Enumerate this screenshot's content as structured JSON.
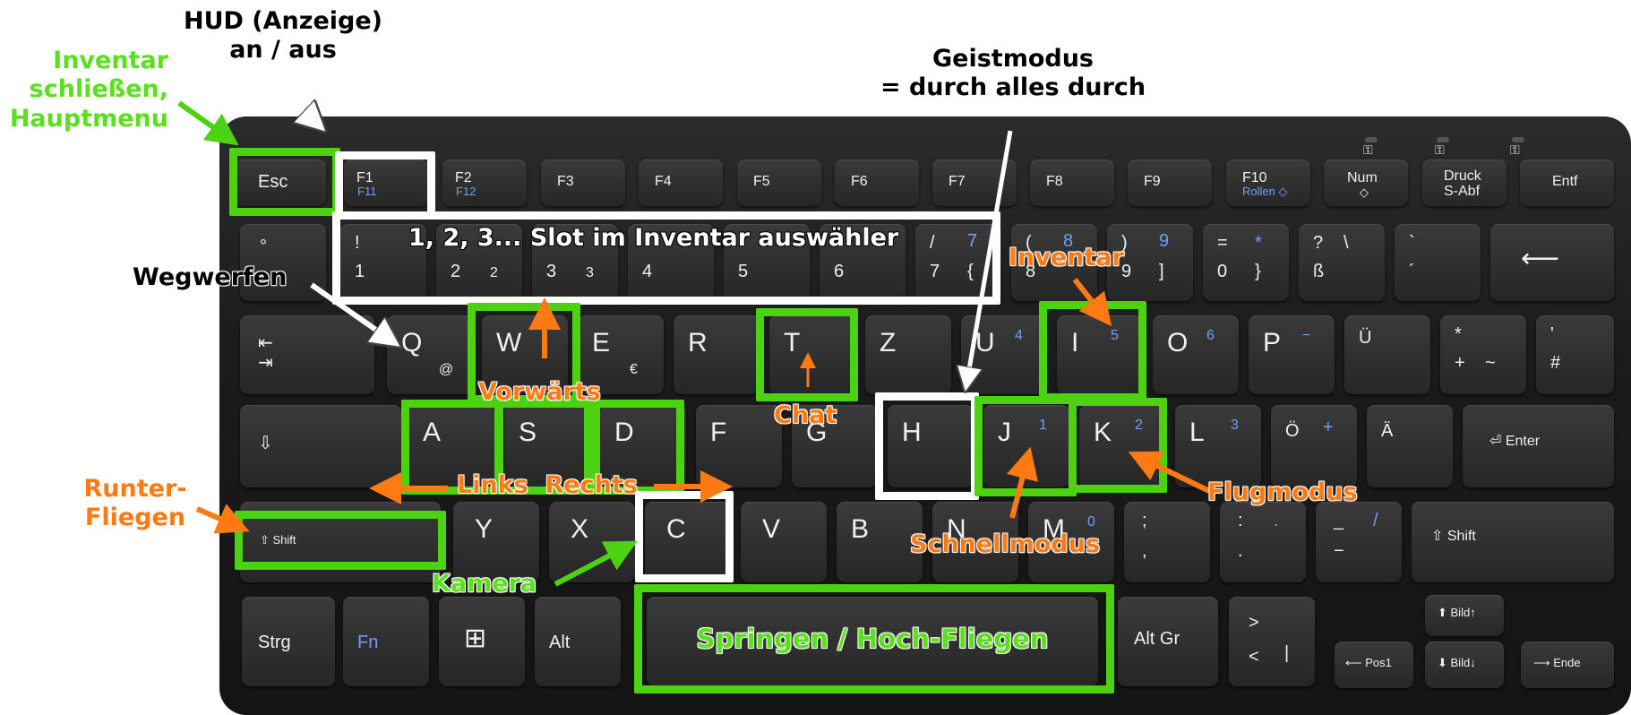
{
  "keys": {
    "esc": "Esc",
    "f1": "F1",
    "f1_sub": "F11",
    "f2": "F2",
    "f2_sub": "F12",
    "f3": "F3",
    "f4": "F4",
    "f5": "F5",
    "f6": "F6",
    "f7": "F7",
    "f8": "F8",
    "f9": "F9",
    "f10": "F10",
    "f10_sub": "Rollen ◇",
    "num": "Num",
    "num_sub": "◇",
    "druck": "Druck",
    "druck_sub": "S-Abf",
    "entf": "Entf",
    "circ": "°",
    "n1_top": "!",
    "n1": "1",
    "n2": "2",
    "n2_sup": "2",
    "n3": "3",
    "n3_sup": "3",
    "n4": "4",
    "n5": "5",
    "n6": "6",
    "n7_top": "/",
    "n7_blue": "7",
    "n7": "7",
    "n7_b": "{",
    "n8_top": "(",
    "n8_blue": "8",
    "n8": "8",
    "n9_top": ")",
    "n9_blue": "9",
    "n9": "9",
    "n9_b": "]",
    "n0_top": "=",
    "n0_blue": "*",
    "n0": "0",
    "n0_b": "}",
    "ss_top": "?",
    "ss_b": "\\",
    "ss": "ß",
    "acc_top": "`",
    "acc": "´",
    "backspace": "⟵",
    "tab": "⇤\n⇥",
    "q": "Q",
    "q_alt": "@",
    "w": "W",
    "e": "E",
    "e_alt": "€",
    "r": "R",
    "t": "T",
    "z": "Z",
    "u": "U",
    "u_blue": "4",
    "i": "I",
    "i_blue": "5",
    "o": "O",
    "o_blue": "6",
    "p": "P",
    "p_blue": "−",
    "ue": "Ü",
    "plus_top": "*",
    "plus": "+",
    "plus_alt": "~",
    "hash_top": "'",
    "hash": "#",
    "caps": "⇩",
    "a": "A",
    "s": "S",
    "d": "D",
    "f": "F",
    "g": "G",
    "h": "H",
    "j": "J",
    "j_blue": "1",
    "k": "K",
    "k_blue": "2",
    "l": "L",
    "l_blue": "3",
    "oe": "Ö",
    "oe_blue": "+",
    "ae": "Ä",
    "enter": "⏎ Enter",
    "lshift": "⇧ Shift",
    "y": "Y",
    "x": "X",
    "c": "C",
    "v": "V",
    "b": "B",
    "n": "N",
    "m": "M",
    "m_blue": "0",
    "comma_top": ";",
    "comma": ",",
    "dot_top": ":",
    "dot": ".",
    "dot_blue": ".",
    "minus_top": "_",
    "minus": "−",
    "minus_blue": "/",
    "rshift": "⇧ Shift",
    "strg": "Strg",
    "fn": "Fn",
    "win": "⊞",
    "alt": "Alt",
    "altgr": "Alt Gr",
    "lt_top": ">",
    "lt": "<",
    "lt_b": "|",
    "pos1": "⟵ Pos1",
    "bild_up": "⬆ Bild↑",
    "bild_down": "⬇ Bild↓",
    "ende": "⟶ Ende"
  },
  "labels": {
    "inventar_schliessen": "Inventar\nschließen,\nHauptmenu",
    "hud": "HUD (Anzeige)\nan / aus",
    "geistmodus": "Geistmodus\n= durch alles durch",
    "slots": "1, 2, 3... Slot im Inventar auswähler",
    "wegwerfen": "Wegwerfen",
    "inventar": "Inventar",
    "vorwaerts": "Vorwärts",
    "chat": "Chat",
    "links_rechts": "Links  Rechts",
    "runter": "Runter-\nFliegen",
    "flugmodus": "Flugmodus",
    "schnellmodus": "Schnellmodus",
    "kamera": "Kamera",
    "springen": "Springen / Hoch-Fliegen"
  },
  "colors": {
    "highlight_green": "#4dd211",
    "highlight_white": "#ffffff",
    "label_orange": "#ff7a12",
    "label_green": "#5be01e",
    "key_blue": "#6fa0ff"
  }
}
